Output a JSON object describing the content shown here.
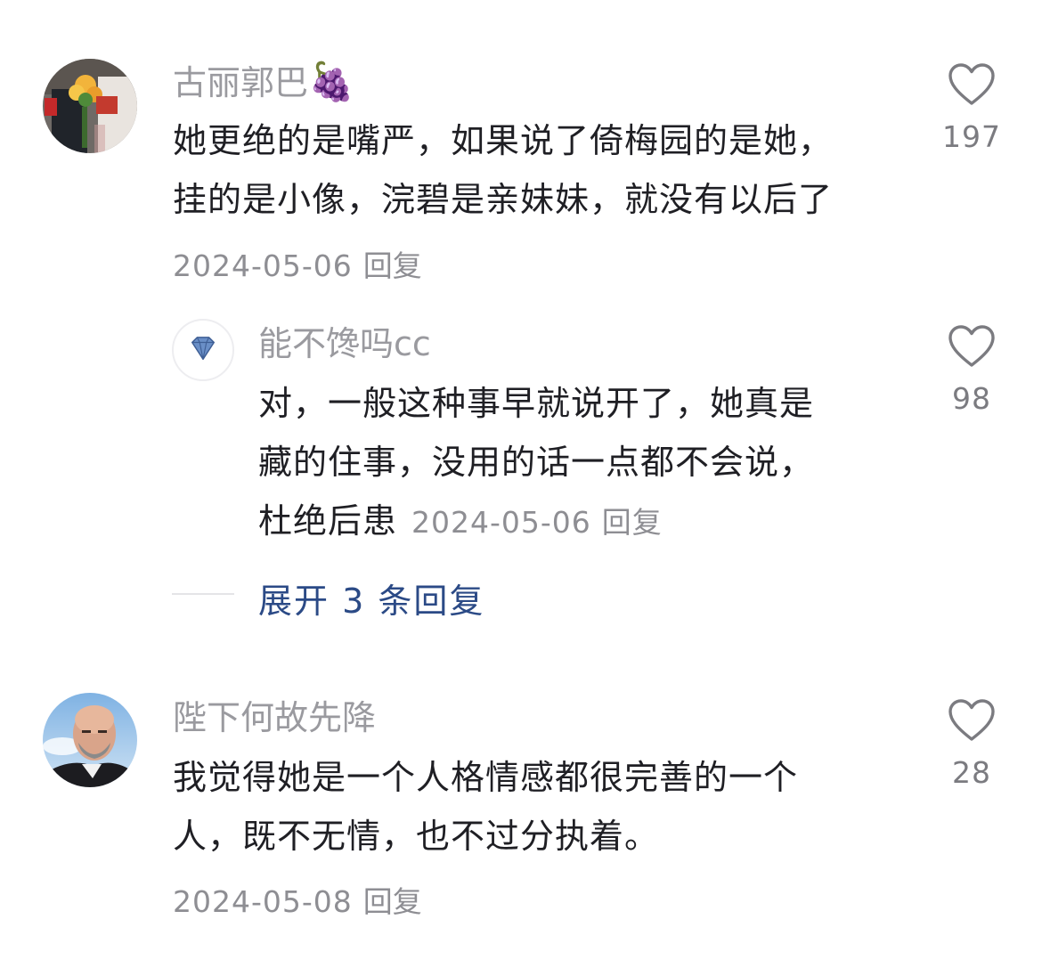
{
  "comments": [
    {
      "username": "古丽郭巴",
      "username_emoji": "🍇",
      "avatar": "wedding-photo-avatar",
      "text_lines": [
        "她更绝的是嘴严，如果说了倚梅园的是她，",
        "挂的是小像，浣碧是亲妹妹，就没有以后了"
      ],
      "date": "2024-05-06",
      "reply_label": "回复",
      "likes": "197",
      "replies": [
        {
          "username": "能不馋吗cc",
          "avatar": "diamond-avatar",
          "text_lines": [
            "对，一般这种事早就说开了，她真是",
            "藏的住事，没用的话一点都不会说，",
            "杜绝后患"
          ],
          "date": "2024-05-06",
          "reply_label": "回复",
          "likes": "98"
        }
      ],
      "expand_label": "展开 3 条回复"
    },
    {
      "username": "陛下何故先降",
      "avatar": "bald-man-portrait-avatar",
      "text_lines": [
        "我觉得她是一个人格情感都很完善的一个",
        "人，既不无情，也不过分执着。"
      ],
      "date": "2024-05-08",
      "reply_label": "回复",
      "likes": "28"
    }
  ],
  "colors": {
    "username": "#9a9a9f",
    "body_text": "#1f1f24",
    "meta": "#8e8e93",
    "expand_link": "#2b4a86"
  }
}
